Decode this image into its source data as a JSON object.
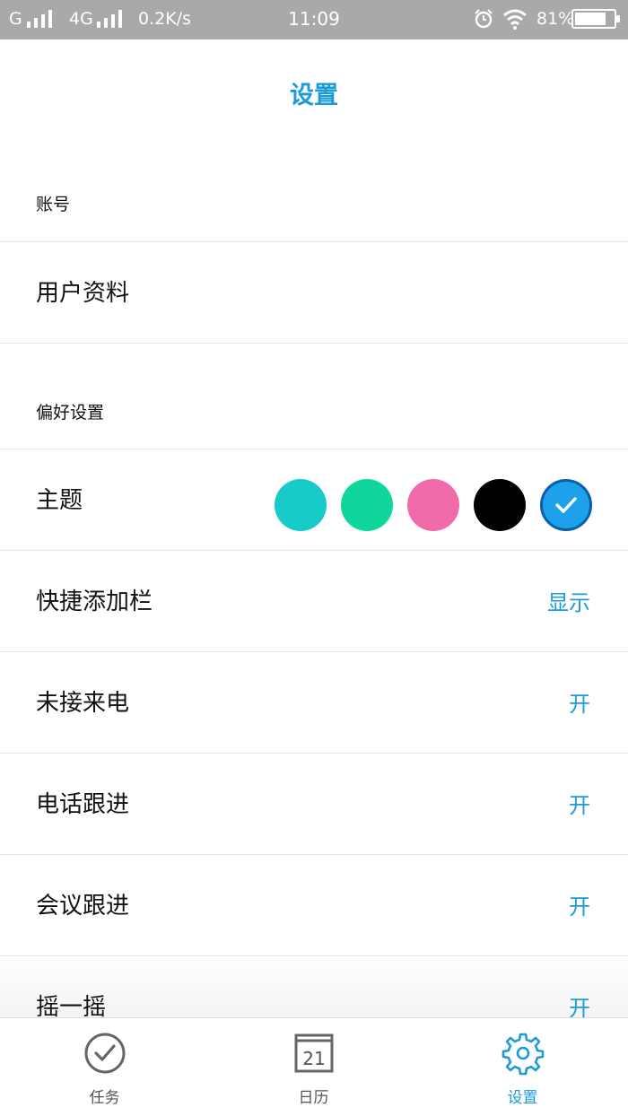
{
  "status_bar": {
    "carrier1": "G",
    "carrier2": "4G",
    "speed": "0.2K/s",
    "time": "11:09",
    "battery_text": "81%",
    "battery_level": 0.81
  },
  "header": {
    "title": "设置"
  },
  "sections": {
    "account_label": "账号",
    "preferences_label": "偏好设置"
  },
  "rows": {
    "user_profile": {
      "label": "用户资料"
    },
    "theme": {
      "label": "主题",
      "colors": [
        "#17cbc9",
        "#0fd79c",
        "#f06ba9",
        "#000000",
        "#1da1ea"
      ],
      "selected_index": 4
    },
    "quick_add_bar": {
      "label": "快捷添加栏",
      "value": "显示"
    },
    "missed_call": {
      "label": "未接来电",
      "value": "开"
    },
    "call_followup": {
      "label": "电话跟进",
      "value": "开"
    },
    "meeting_followup": {
      "label": "会议跟进",
      "value": "开"
    },
    "shake": {
      "label": "摇一摇",
      "value": "开"
    }
  },
  "tabbar": {
    "tasks": {
      "label": "任务",
      "icon": "check-circle-icon"
    },
    "calendar": {
      "label": "日历",
      "icon": "calendar-icon",
      "day": "21"
    },
    "settings": {
      "label": "设置",
      "icon": "gear-icon"
    }
  },
  "colors": {
    "accent": "#1b9bd8",
    "status_bar": "#a9a9a9"
  }
}
